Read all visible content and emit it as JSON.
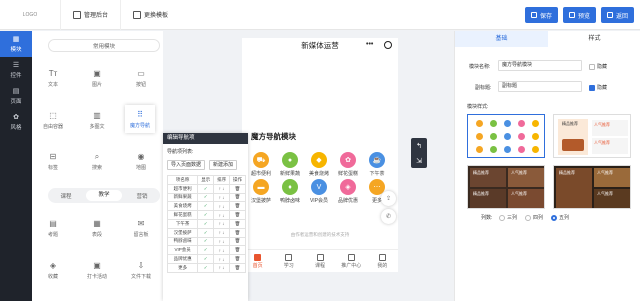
{
  "topbar": {
    "logo": "LOGO",
    "nav": [
      {
        "label": "管理后台",
        "icon": "home-icon"
      },
      {
        "label": "更换模板",
        "icon": "template-icon"
      }
    ],
    "buttons": [
      {
        "label": "保存",
        "icon": "save-icon"
      },
      {
        "label": "预览",
        "icon": "preview-icon"
      },
      {
        "label": "返回",
        "icon": "back-icon"
      }
    ]
  },
  "rail": [
    {
      "label": "模块",
      "icon": "grid-icon",
      "active": true
    },
    {
      "label": "控件",
      "icon": "controls-icon"
    },
    {
      "label": "页面",
      "icon": "page-icon"
    },
    {
      "label": "风格",
      "icon": "palette-icon"
    }
  ],
  "panel": {
    "common_label": "常用模块",
    "components_top": [
      "文本",
      "图片",
      "按钮",
      "自由容器",
      "多图文",
      "魔方导航",
      "标签",
      "搜索",
      "地图"
    ],
    "tabs": [
      {
        "label": "课程",
        "active": false
      },
      {
        "label": "教学",
        "active": true
      },
      {
        "label": "营销",
        "active": false
      }
    ],
    "components_bottom": [
      "考题",
      "表段",
      "留言板",
      "收藏",
      "打卡活动",
      "文件下载"
    ]
  },
  "phone": {
    "title": "新媒体运营",
    "module_title": "魔方导航模块",
    "nav_items": [
      {
        "label": "超市便利",
        "color": "#f5a623",
        "icon": "cart-icon"
      },
      {
        "label": "新鲜果蔬",
        "color": "#7ac143",
        "icon": "apple-icon"
      },
      {
        "label": "美食烧烤",
        "color": "#f7b500",
        "icon": "food-icon"
      },
      {
        "label": "鲜花蛋糕",
        "color": "#f06a9a",
        "icon": "cake-icon"
      },
      {
        "label": "下午茶",
        "color": "#4a90e2",
        "icon": "tea-icon"
      },
      {
        "label": "汉堡披萨",
        "color": "#f5a623",
        "icon": "burger-icon"
      },
      {
        "label": "鸭脖卤味",
        "color": "#7ac143",
        "icon": "duck-icon"
      },
      {
        "label": "VIP会员",
        "color": "#4a90e2",
        "icon": "vip-icon"
      },
      {
        "label": "品牌优惠",
        "color": "#f06a9a",
        "icon": "tag-icon"
      },
      {
        "label": "更多",
        "color": "#f5a623",
        "icon": "more-icon"
      }
    ],
    "footer_note": "由作者运营和创建的技术支持",
    "tabbar": [
      {
        "label": "首页",
        "active": true
      },
      {
        "label": "学习"
      },
      {
        "label": "课程"
      },
      {
        "label": "推广中心"
      },
      {
        "label": "我的"
      }
    ]
  },
  "popup": {
    "title": "编辑导航项",
    "list_label": "导航项列表:",
    "btn_import": "导入页面数据",
    "btn_add": "新建添加",
    "headers": [
      "项名称",
      "显示",
      "排序",
      "操作"
    ],
    "rows": [
      "超市便利",
      "新鲜果蔬",
      "美食烧烤",
      "鲜花蛋糕",
      "下午茶",
      "汉堡披萨",
      "鸭脖卤味",
      "VIP会员",
      "品牌优惠",
      "更多"
    ]
  },
  "right": {
    "tabs": [
      {
        "label": "基础",
        "active": true
      },
      {
        "label": "样式",
        "active": false
      }
    ],
    "module_name_label": "模块名称:",
    "module_name_value": "魔方导航模块",
    "hide_label": "隐藏",
    "subtitle_label": "副标题:",
    "subtitle_value": "副标题",
    "style_label": "模块样式:",
    "cols_label": "列数:",
    "cols": [
      {
        "label": "三列",
        "selected": false
      },
      {
        "label": "四列",
        "selected": false
      },
      {
        "label": "五列",
        "selected": true
      }
    ],
    "card_texts": {
      "c2_title": "精品推荐",
      "c2_sub": "人气推荐",
      "c4_a": "精品推荐",
      "c4_b": "人气推荐",
      "c4_c": "精品推荐",
      "c4_d": "人气推荐",
      "c5_a": "精品推荐",
      "c5_b": "人气推荐",
      "c5_c": "人气推荐"
    }
  }
}
